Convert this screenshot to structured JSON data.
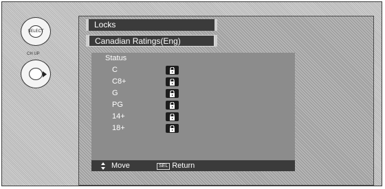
{
  "remote": {
    "top_button_label": "SELECT",
    "divider_label": "CH UP",
    "play_icon": "triangle-right-icon"
  },
  "menu": {
    "title": "Locks",
    "subtitle": "Canadian Ratings(Eng)",
    "status_heading": "Status",
    "ratings": [
      {
        "label": "C",
        "state": "locked"
      },
      {
        "label": "C8+",
        "state": "locked"
      },
      {
        "label": "G",
        "state": "locked"
      },
      {
        "label": "PG",
        "state": "locked"
      },
      {
        "label": "14+",
        "state": "locked"
      },
      {
        "label": "18+",
        "state": "locked"
      }
    ]
  },
  "footer": {
    "move_label": "Move",
    "sel_key": "SEL",
    "return_label": "Return"
  }
}
